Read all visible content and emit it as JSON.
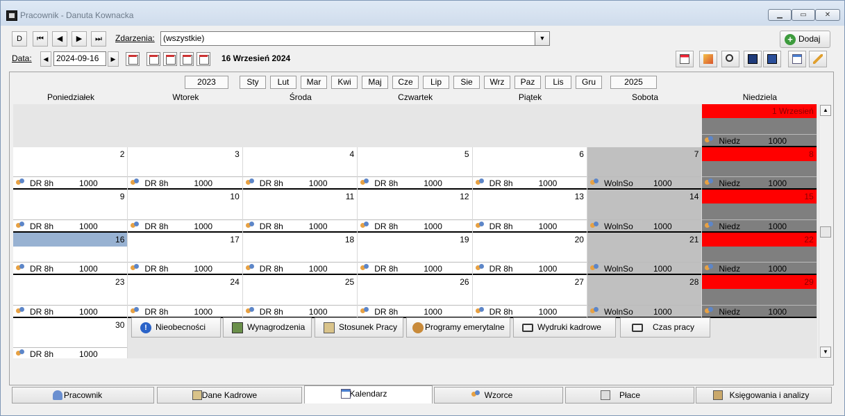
{
  "window": {
    "title": "Pracownik - Danuta Kownacka",
    "controls": [
      "▁",
      "▭",
      "✕"
    ]
  },
  "toolbar": {
    "nav": [
      "D",
      "⏮",
      "◀",
      "▶",
      "⏭"
    ],
    "events_label": "Zdarzenia:",
    "events_value": "(wszystkie)",
    "add_label": "Dodaj",
    "date_label": "Data:",
    "date_value": "2024-09-16",
    "date_title": "16 Wrzesień 2024"
  },
  "months": {
    "prev_year": "2023",
    "next_year": "2025",
    "items": [
      "Sty",
      "Lut",
      "Mar",
      "Kwi",
      "Maj",
      "Cze",
      "Lip",
      "Sie",
      "Wrz",
      "Paz",
      "Lis",
      "Gru"
    ]
  },
  "weekdays": [
    "Poniedziałek",
    "Wtorek",
    "Środa",
    "Czwartek",
    "Piątek",
    "Sobota",
    "Niedziela"
  ],
  "calendar": {
    "rows": [
      [
        null,
        null,
        null,
        null,
        null,
        null,
        {
          "num": "1 Wrzesień",
          "code": "Niedz",
          "val": "1000",
          "type": "sun"
        }
      ],
      [
        {
          "num": "2",
          "code": "DR 8h",
          "val": "1000"
        },
        {
          "num": "3",
          "code": "DR 8h",
          "val": "1000"
        },
        {
          "num": "4",
          "code": "DR 8h",
          "val": "1000"
        },
        {
          "num": "5",
          "code": "DR 8h",
          "val": "1000"
        },
        {
          "num": "6",
          "code": "DR 8h",
          "val": "1000"
        },
        {
          "num": "7",
          "code": "WolnSo",
          "val": "1000",
          "type": "sat"
        },
        {
          "num": "8",
          "code": "Niedz",
          "val": "1000",
          "type": "sun"
        }
      ],
      [
        {
          "num": "9",
          "code": "DR 8h",
          "val": "1000"
        },
        {
          "num": "10",
          "code": "DR 8h",
          "val": "1000"
        },
        {
          "num": "11",
          "code": "DR 8h",
          "val": "1000"
        },
        {
          "num": "12",
          "code": "DR 8h",
          "val": "1000"
        },
        {
          "num": "13",
          "code": "DR 8h",
          "val": "1000"
        },
        {
          "num": "14",
          "code": "WolnSo",
          "val": "1000",
          "type": "sat"
        },
        {
          "num": "15",
          "code": "Niedz",
          "val": "1000",
          "type": "sun"
        }
      ],
      [
        {
          "num": "16",
          "code": "DR 8h",
          "val": "1000",
          "type": "today"
        },
        {
          "num": "17",
          "code": "DR 8h",
          "val": "1000"
        },
        {
          "num": "18",
          "code": "DR 8h",
          "val": "1000"
        },
        {
          "num": "19",
          "code": "DR 8h",
          "val": "1000"
        },
        {
          "num": "20",
          "code": "DR 8h",
          "val": "1000"
        },
        {
          "num": "21",
          "code": "WolnSo",
          "val": "1000",
          "type": "sat"
        },
        {
          "num": "22",
          "code": "Niedz",
          "val": "1000",
          "type": "sun"
        }
      ],
      [
        {
          "num": "23",
          "code": "DR 8h",
          "val": "1000"
        },
        {
          "num": "24",
          "code": "DR 8h",
          "val": "1000"
        },
        {
          "num": "25",
          "code": "DR 8h",
          "val": "1000"
        },
        {
          "num": "26",
          "code": "DR 8h",
          "val": "1000"
        },
        {
          "num": "27",
          "code": "DR 8h",
          "val": "1000"
        },
        {
          "num": "28",
          "code": "WolnSo",
          "val": "1000",
          "type": "sat"
        },
        {
          "num": "29",
          "code": "Niedz",
          "val": "1000",
          "type": "sun"
        }
      ],
      [
        {
          "num": "30",
          "code": "DR 8h",
          "val": "1000"
        },
        null,
        null,
        null,
        null,
        null,
        null
      ]
    ]
  },
  "bottom_buttons": [
    "Nieobecności",
    "Wynagrodzenia",
    "Stosunek Pracy",
    "Programy emerytalne",
    "Wydruki kadrowe",
    "Czas pracy"
  ],
  "tabs": [
    "Pracownik",
    "Dane Kadrowe",
    "Kalendarz",
    "Wzorce",
    "Płace",
    "Księgowania i analizy"
  ],
  "active_tab": "Kalendarz"
}
